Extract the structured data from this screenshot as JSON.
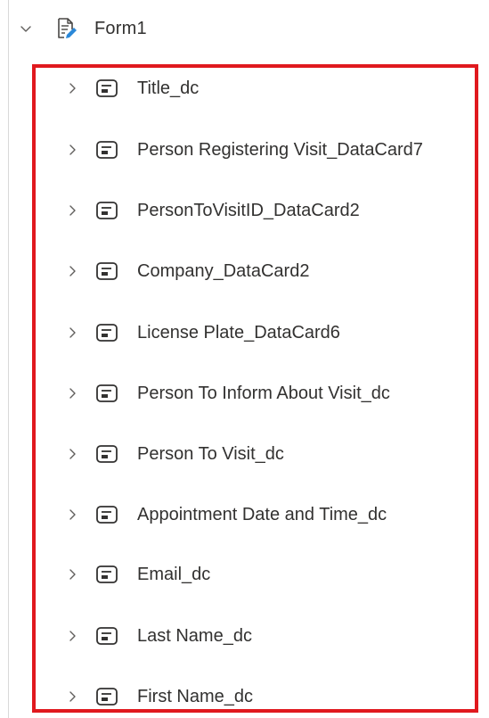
{
  "form": {
    "label": "Form1",
    "expanded": true
  },
  "cards": [
    {
      "label": "Title_dc"
    },
    {
      "label": "Person Registering Visit_DataCard7"
    },
    {
      "label": "PersonToVisitID_DataCard2"
    },
    {
      "label": "Company_DataCard2"
    },
    {
      "label": "License Plate_DataCard6"
    },
    {
      "label": "Person To Inform About Visit_dc"
    },
    {
      "label": "Person To Visit_dc"
    },
    {
      "label": "Appointment Date and Time_dc"
    },
    {
      "label": "Email_dc"
    },
    {
      "label": "Last Name_dc"
    },
    {
      "label": "First Name_dc"
    }
  ],
  "icons": {
    "expand": "chevron-down-icon",
    "collapse": "chevron-right-icon",
    "form": "form-edit-icon",
    "card": "data-card-icon"
  },
  "colors": {
    "highlight_border": "#e0191e",
    "form_pen_accent": "#2b88d8",
    "text": "#323130"
  }
}
